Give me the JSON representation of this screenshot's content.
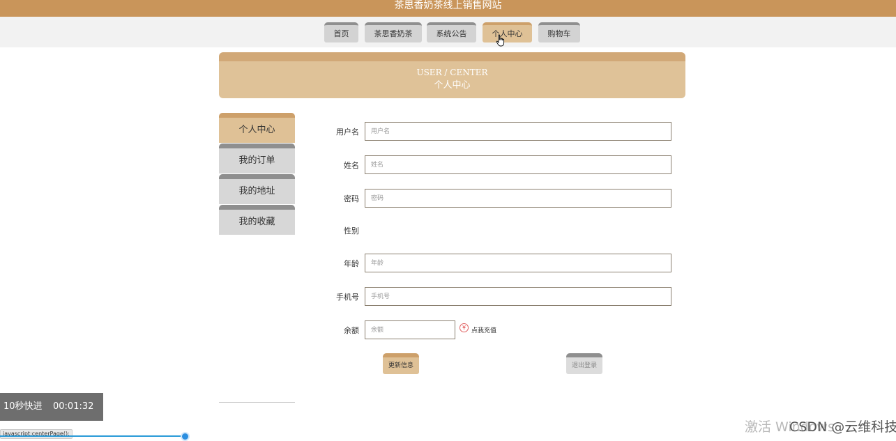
{
  "site_title": "茶思香奶茶线上销售网站",
  "nav": [
    {
      "label": "首页"
    },
    {
      "label": "茶思香奶茶"
    },
    {
      "label": "系统公告"
    },
    {
      "label": "个人中心",
      "active": true
    },
    {
      "label": "购物车"
    }
  ],
  "banner": {
    "en": "USER / CENTER",
    "cn": "个人中心"
  },
  "sidebar": [
    {
      "label": "个人中心",
      "active": true
    },
    {
      "label": "我的订单"
    },
    {
      "label": "我的地址"
    },
    {
      "label": "我的收藏"
    }
  ],
  "form": {
    "username": {
      "label": "用户名",
      "placeholder": "用户名",
      "value": ""
    },
    "name": {
      "label": "姓名",
      "placeholder": "姓名",
      "value": ""
    },
    "password": {
      "label": "密码",
      "placeholder": "密码",
      "value": ""
    },
    "gender": {
      "label": "性别"
    },
    "age": {
      "label": "年龄",
      "placeholder": "年龄",
      "value": ""
    },
    "phone": {
      "label": "手机号",
      "placeholder": "手机号",
      "value": ""
    },
    "balance": {
      "label": "余额",
      "placeholder": "余额",
      "value": ""
    }
  },
  "recharge": {
    "icon": "yen-icon",
    "symbol": "¥",
    "label": "点我充值"
  },
  "buttons": {
    "update": "更新信息",
    "logout": "退出登录"
  },
  "player": {
    "fast_forward": "10秒快进",
    "time": "00:01:32"
  },
  "status_text": "javascript:centerPage();",
  "watermark": {
    "activate": "激活 Windows",
    "csdn": "CSDN @云维科技"
  },
  "colors": {
    "header": "#c9955a",
    "accent": "#dfc196",
    "accent_top": "#cda06a",
    "inactive": "#d3d3d3"
  }
}
